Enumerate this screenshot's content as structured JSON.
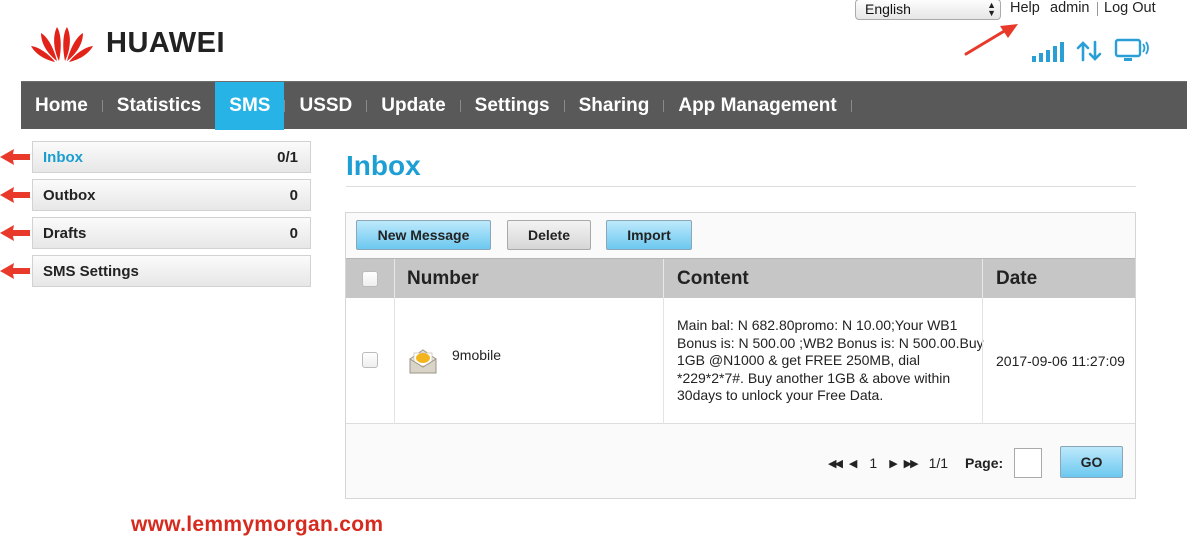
{
  "brand": {
    "name": "HUAWEI",
    "logo_icon": "huawei-petal-logo-icon",
    "logo_color": "#e2231a"
  },
  "topbar": {
    "language": "English",
    "help": "Help",
    "user": "admin",
    "logout": "Log Out",
    "icons": [
      "signal-strength-icon",
      "data-transfer-icon",
      "connected-device-icon"
    ]
  },
  "nav": {
    "items": [
      {
        "label": "Home"
      },
      {
        "label": "Statistics"
      },
      {
        "label": "SMS"
      },
      {
        "label": "USSD"
      },
      {
        "label": "Update"
      },
      {
        "label": "Settings"
      },
      {
        "label": "Sharing"
      },
      {
        "label": "App Management"
      }
    ],
    "active": "SMS",
    "active_color": "#27b3e6"
  },
  "sidebar": {
    "items": [
      {
        "label": "Inbox",
        "count": "0/1"
      },
      {
        "label": "Outbox",
        "count": "0"
      },
      {
        "label": "Drafts",
        "count": "0"
      },
      {
        "label": "SMS Settings",
        "count": ""
      }
    ],
    "active": "Inbox"
  },
  "main": {
    "title": "Inbox",
    "toolbar": {
      "new_message": "New Message",
      "delete": "Delete",
      "import": "Import"
    },
    "table": {
      "columns": [
        "Number",
        "Content",
        "Date"
      ],
      "rows": [
        {
          "number": "9mobile",
          "content": "Main bal: N 682.80promo: N 10.00;Your WB1 Bonus is: N 500.00 ;WB2 Bonus is: N 500.00.Buy 1GB @N1000 & get FREE 250MB, dial *229*2*7#. Buy another 1GB & above within 30days to unlock your Free Data.",
          "date": "2017-09-06 11:27:09",
          "icon": "envelope-open-icon"
        }
      ]
    },
    "pagination": {
      "current": "1",
      "total": "1/1",
      "page_label": "Page:",
      "go": "GO"
    }
  },
  "watermark": "www.lemmymorgan.com"
}
